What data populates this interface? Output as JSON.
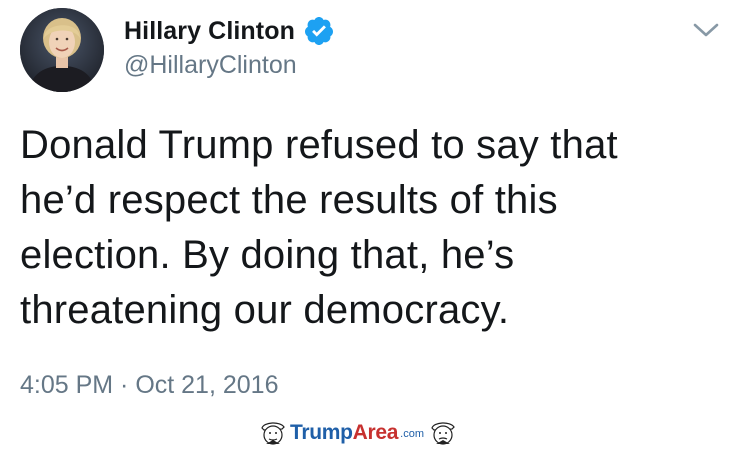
{
  "user": {
    "display_name": "Hillary Clinton",
    "handle": "@HillaryClinton",
    "verified": true
  },
  "tweet": {
    "lines": [
      "Donald Trump refused to say that",
      "he’d respect the results of this",
      "election. By doing that, he’s",
      "threatening our democracy."
    ],
    "timestamp": "4:05 PM · Oct 21, 2016"
  },
  "watermark": {
    "brand_part1": "Trump",
    "brand_part2": "Area",
    "suffix": ".com"
  },
  "icons": {
    "verified": "verified-badge-icon",
    "menu": "chevron-down-icon"
  },
  "colors": {
    "text": "#14171a",
    "secondary": "#657786",
    "verified": "#1da1f2",
    "watermark_blue": "#1f5fa8",
    "watermark_red": "#c7312f"
  }
}
